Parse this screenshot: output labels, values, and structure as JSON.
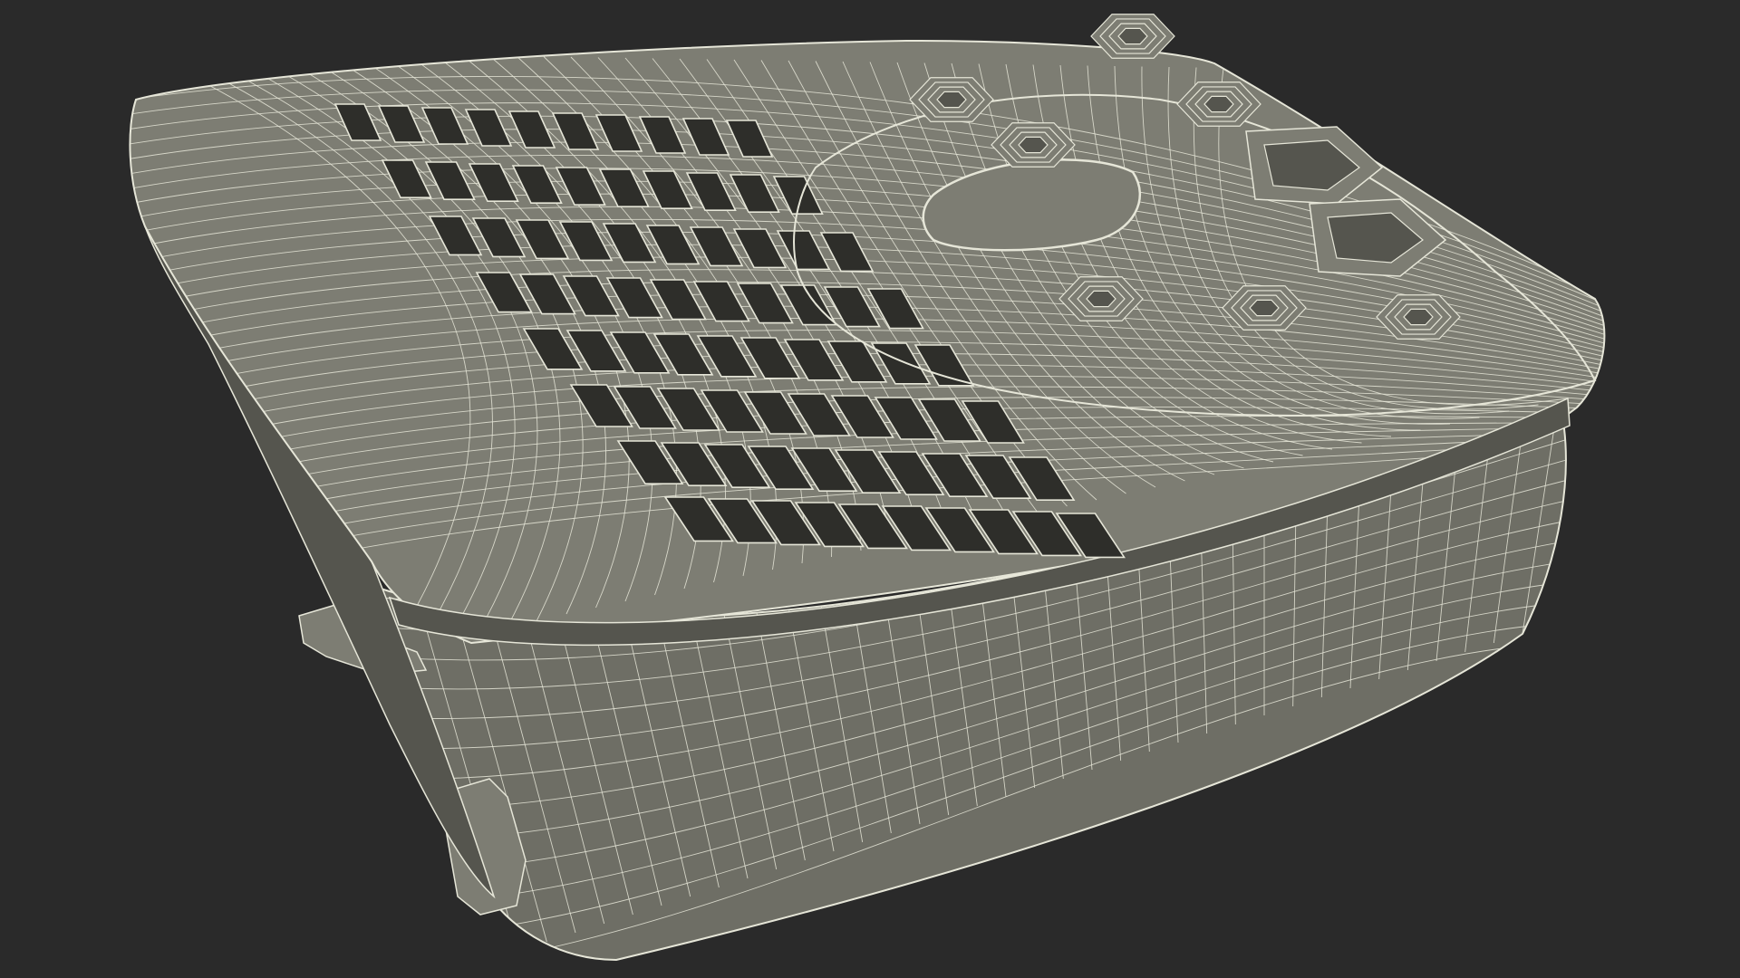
{
  "scene": {
    "background_color": "#2a2a2a",
    "model_fill": "#7d7d73",
    "model_shade": "#6e6e65",
    "model_dark": "#55554e",
    "wire_color": "#e6e6d8",
    "vent_hole_color": "#2e2e2a",
    "vent_rows": 8,
    "vent_cols": 10,
    "buttons_small": 7,
    "buttons_large": 2
  }
}
